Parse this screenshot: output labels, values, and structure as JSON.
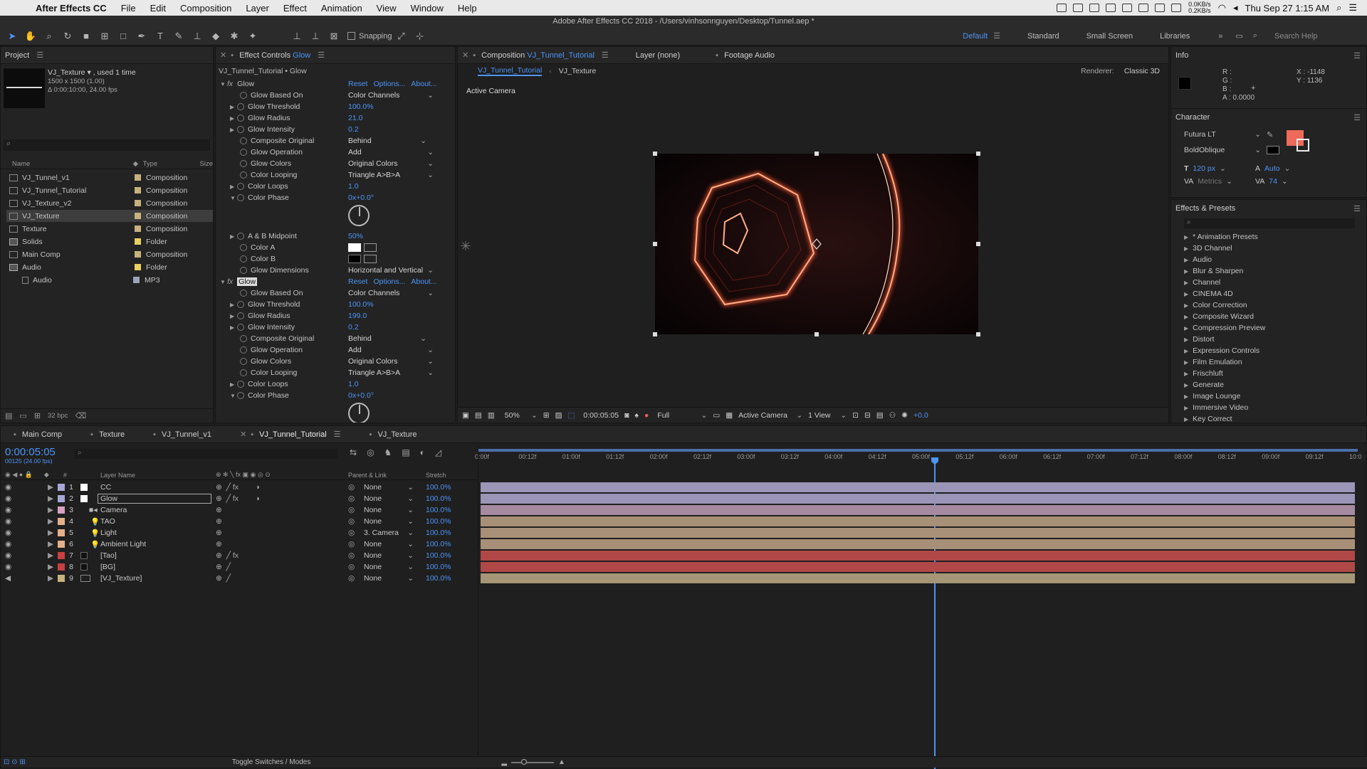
{
  "menubar": {
    "app": "After Effects CC",
    "items": [
      "File",
      "Edit",
      "Composition",
      "Layer",
      "Effect",
      "Animation",
      "View",
      "Window",
      "Help"
    ],
    "net_up": "0.0KB/s",
    "net_down": "0.2KB/s",
    "clock": "Thu Sep 27  1:15 AM"
  },
  "window_title": "Adobe After Effects CC 2018 - /Users/vinhsonnguyen/Desktop/Tunnel.aep *",
  "toolbar": {
    "snapping": "Snapping",
    "workspaces": [
      "Default",
      "Standard",
      "Small Screen",
      "Libraries"
    ],
    "search_help": "Search Help"
  },
  "project": {
    "title": "Project",
    "thumb_name": "VJ_Texture ▾ , used 1 time",
    "thumb_dims": "1500 x 1500 (1.00)",
    "thumb_dur": "Δ 0:00:10:00, 24.00 fps",
    "col_name": "Name",
    "col_type": "Type",
    "col_size": "Size",
    "bpc": "32 bpc",
    "items": [
      {
        "name": "VJ_Tunnel_v1",
        "type": "Composition",
        "color": "#c7b17e"
      },
      {
        "name": "VJ_Tunnel_Tutorial",
        "type": "Composition",
        "color": "#c7b17e"
      },
      {
        "name": "VJ_Texture_v2",
        "type": "Composition",
        "color": "#c7b17e"
      },
      {
        "name": "VJ_Texture",
        "type": "Composition",
        "color": "#c7b17e"
      },
      {
        "name": "Texture",
        "type": "Composition",
        "color": "#c7b17e"
      },
      {
        "name": "Solids",
        "type": "Folder",
        "color": "#e6d15d"
      },
      {
        "name": "Main Comp",
        "type": "Composition",
        "color": "#c7b17e"
      },
      {
        "name": "Audio",
        "type": "Folder",
        "color": "#e6d15d"
      },
      {
        "name": "Audio",
        "type": "MP3",
        "color": "#9aa5b5"
      }
    ]
  },
  "effect_controls": {
    "title": "Effect Controls",
    "layer": "Glow",
    "breadcrumb": "VJ_Tunnel_Tutorial • Glow",
    "reset": "Reset",
    "options": "Options...",
    "about": "About...",
    "effect1": {
      "name": "Glow",
      "based_on": "Color Channels",
      "threshold": "100.0%",
      "radius": "21.0",
      "intensity": "0.2",
      "composite": "Behind",
      "operation": "Add",
      "colors": "Original Colors",
      "looping": "Triangle A>B>A",
      "loops": "1.0",
      "phase": "0x+0.0°",
      "midpoint": "50%",
      "dimensions": "Horizontal and Vertical"
    },
    "effect2": {
      "name": "Glow",
      "based_on": "Color Channels",
      "threshold": "100.0%",
      "radius": "199.0",
      "intensity": "0.2",
      "composite": "Behind",
      "operation": "Add",
      "colors": "Original Colors",
      "looping": "Triangle A>B>A",
      "loops": "1.0",
      "phase": "0x+0.0°"
    },
    "labels": {
      "based_on": "Glow Based On",
      "threshold": "Glow Threshold",
      "radius": "Glow Radius",
      "intensity": "Glow Intensity",
      "composite": "Composite Original",
      "operation": "Glow Operation",
      "colors": "Glow Colors",
      "looping": "Color Looping",
      "loops": "Color Loops",
      "phase": "Color Phase",
      "midpoint": "A & B Midpoint",
      "color_a": "Color A",
      "color_b": "Color B",
      "dimensions": "Glow Dimensions"
    }
  },
  "composition": {
    "title": "Composition",
    "comp_name": "VJ_Tunnel_Tutorial",
    "layer_tab": "Layer (none)",
    "footage_tab": "Footage Audio",
    "crumb1": "VJ_Tunnel_Tutorial",
    "crumb2": "VJ_Texture",
    "renderer_label": "Renderer:",
    "renderer": "Classic 3D",
    "active_camera": "Active Camera",
    "footer": {
      "zoom": "50%",
      "time": "0:00:05:05",
      "res": "Full",
      "camera": "Active Camera",
      "view": "1 View",
      "exposure": "+0.0"
    }
  },
  "info": {
    "title": "Info",
    "r": "R :",
    "g": "G :",
    "b": "B :",
    "a": "A :  0.0000",
    "x": "X : -1148",
    "y": "Y : 1136"
  },
  "character": {
    "title": "Character",
    "font": "Futura LT",
    "style": "BoldOblique",
    "size": "120 px",
    "leading": "Auto",
    "kerning": "Metrics",
    "tracking": "74",
    "fill": "#ee6a5a"
  },
  "effects_presets": {
    "title": "Effects & Presets",
    "items": [
      "* Animation Presets",
      "3D Channel",
      "Audio",
      "Blur & Sharpen",
      "Channel",
      "CINEMA 4D",
      "Color Correction",
      "Composite Wizard",
      "Compression Preview",
      "Distort",
      "Expression Controls",
      "Film Emulation",
      "Frischluft",
      "Generate",
      "Image Lounge",
      "Immersive Video",
      "Key Correct"
    ]
  },
  "timeline": {
    "tabs": [
      "Main Comp",
      "Texture",
      "VJ_Tunnel_v1",
      "VJ_Tunnel_Tutorial",
      "VJ_Texture"
    ],
    "timecode": "0:00:05:05",
    "frames": "00125 (24.00 fps)",
    "col_layer": "Layer Name",
    "col_parent": "Parent & Link",
    "col_stretch": "Stretch",
    "toggle": "Toggle Switches / Modes",
    "ruler": [
      "0:00f",
      "00:12f",
      "01:00f",
      "01:12f",
      "02:00f",
      "02:12f",
      "03:00f",
      "03:12f",
      "04:00f",
      "04:12f",
      "05:00f",
      "05:12f",
      "06:00f",
      "06:12f",
      "07:00f",
      "07:12f",
      "08:00f",
      "08:12f",
      "09:00f",
      "09:12f",
      "10:0"
    ],
    "layers": [
      {
        "num": "1",
        "name": "CC",
        "parent": "None",
        "stretch": "100.0%",
        "color": "#a7a7d6",
        "bar": "#9b95b8"
      },
      {
        "num": "2",
        "name": "Glow",
        "parent": "None",
        "stretch": "100.0%",
        "color": "#a7a7d6",
        "bar": "#9b95b8"
      },
      {
        "num": "3",
        "name": "Camera",
        "parent": "None",
        "stretch": "100.0%",
        "color": "#d9a0c2",
        "bar": "#a58aa0"
      },
      {
        "num": "4",
        "name": "TAO",
        "parent": "None",
        "stretch": "100.0%",
        "color": "#e4b089",
        "bar": "#a89078"
      },
      {
        "num": "5",
        "name": "Light",
        "parent": "3. Camera",
        "stretch": "100.0%",
        "color": "#e4b089",
        "bar": "#a89078"
      },
      {
        "num": "6",
        "name": "Ambient Light",
        "parent": "None",
        "stretch": "100.0%",
        "color": "#e4b089",
        "bar": "#a89078"
      },
      {
        "num": "7",
        "name": "[Tao]",
        "parent": "None",
        "stretch": "100.0%",
        "color": "#c94040",
        "bar": "#b04848"
      },
      {
        "num": "8",
        "name": "[BG]",
        "parent": "None",
        "stretch": "100.0%",
        "color": "#c94040",
        "bar": "#b04848"
      },
      {
        "num": "9",
        "name": "[VJ_Texture]",
        "parent": "None",
        "stretch": "100.0%",
        "color": "#c7b17e",
        "bar": "#a59775"
      }
    ]
  }
}
